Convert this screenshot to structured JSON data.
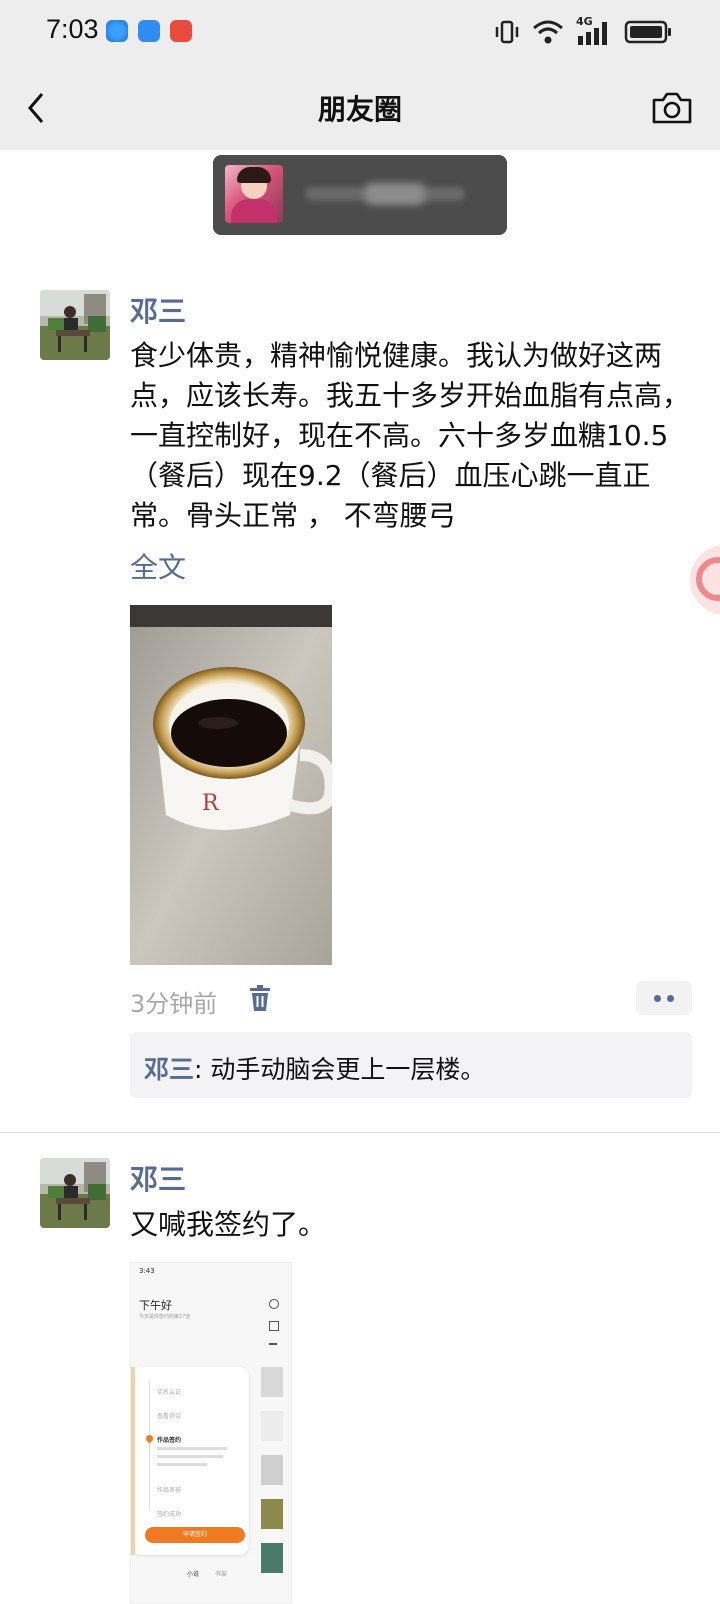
{
  "status_bar": {
    "time": "7:03",
    "network": "4G",
    "app_icons": [
      "browser-icon",
      "messenger-icon",
      "news-app-icon"
    ]
  },
  "nav": {
    "title": "朋友圈",
    "back_icon": "chevron-left-icon",
    "camera_icon": "camera-icon"
  },
  "posts": [
    {
      "author": "邓三",
      "text": "食少体贵，精神愉悦健康。我认为做好这两点，应该长寿。我五十多岁开始血脂有点高，一直控制好，现在不高。六十多岁血糖10.5（餐后）现在9.2（餐后）血压心跳一直正常。骨头正常 ， 不弯腰弓",
      "expand_label": "全文",
      "time": "3分钟前",
      "comment": {
        "name": "邓三",
        "text": ": 动手动脑会更上一层楼。"
      }
    },
    {
      "author": "邓三",
      "text": "又喊我签约了。",
      "screenshot": {
        "time": "3:43",
        "greeting": "下午好",
        "subtext": "今天是你签约的第17天",
        "items": [
          "实名认证",
          "查看协议",
          "作品签约",
          "作品审核",
          "签约成功"
        ],
        "button": "申请签约",
        "tabs": [
          "小说",
          "书架"
        ]
      }
    }
  ],
  "colors": {
    "accent": "#576b95",
    "bar_bg": "#ededed",
    "comment_bg": "#f3f3f5",
    "orange": "#f07a22"
  }
}
